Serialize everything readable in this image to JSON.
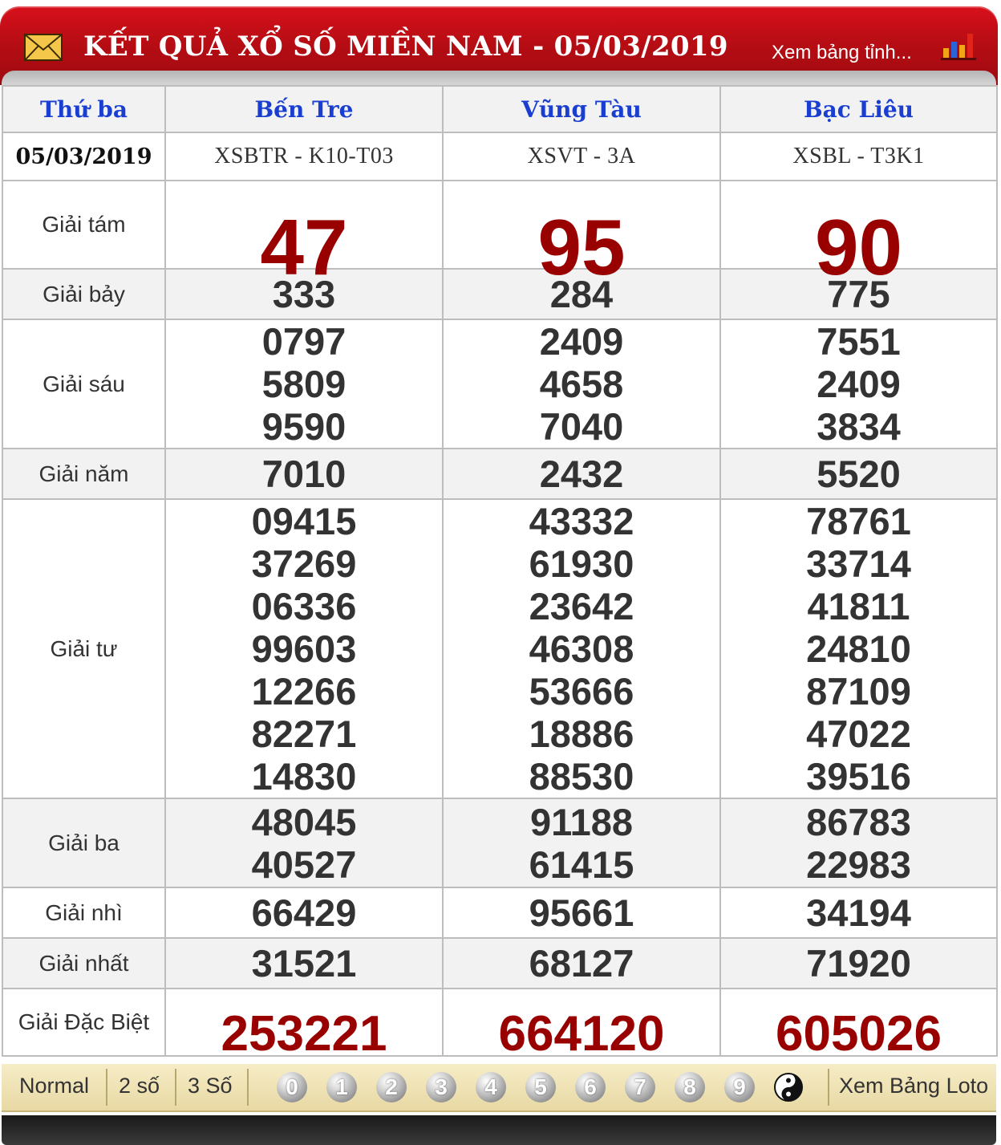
{
  "header": {
    "title": "KẾT QUẢ XỔ SỐ MIỀN NAM - 05/03/2019",
    "view_link": "Xem bảng tỉnh..."
  },
  "table": {
    "day": "Thứ ba",
    "date": "05/03/2019",
    "provinces": [
      {
        "name": "Bến Tre",
        "code": "XSBTR - K10-T03"
      },
      {
        "name": "Vũng Tàu",
        "code": "XSVT - 3A"
      },
      {
        "name": "Bạc Liêu",
        "code": "XSBL - T3K1"
      }
    ],
    "prizes": {
      "g8": {
        "label": "Giải tám",
        "values": [
          [
            "47"
          ],
          [
            "95"
          ],
          [
            "90"
          ]
        ]
      },
      "g7": {
        "label": "Giải bảy",
        "values": [
          [
            "333"
          ],
          [
            "284"
          ],
          [
            "775"
          ]
        ]
      },
      "g6": {
        "label": "Giải sáu",
        "values": [
          [
            "0797",
            "5809",
            "9590"
          ],
          [
            "2409",
            "4658",
            "7040"
          ],
          [
            "7551",
            "2409",
            "3834"
          ]
        ]
      },
      "g5": {
        "label": "Giải năm",
        "values": [
          [
            "7010"
          ],
          [
            "2432"
          ],
          [
            "5520"
          ]
        ]
      },
      "g4": {
        "label": "Giải tư",
        "values": [
          [
            "09415",
            "37269",
            "06336",
            "99603",
            "12266",
            "82271",
            "14830"
          ],
          [
            "43332",
            "61930",
            "23642",
            "46308",
            "53666",
            "18886",
            "88530"
          ],
          [
            "78761",
            "33714",
            "41811",
            "24810",
            "87109",
            "47022",
            "39516"
          ]
        ]
      },
      "g3": {
        "label": "Giải ba",
        "values": [
          [
            "48045",
            "40527"
          ],
          [
            "91188",
            "61415"
          ],
          [
            "86783",
            "22983"
          ]
        ]
      },
      "g2": {
        "label": "Giải nhì",
        "values": [
          [
            "66429"
          ],
          [
            "95661"
          ],
          [
            "34194"
          ]
        ]
      },
      "g1": {
        "label": "Giải nhất",
        "values": [
          [
            "31521"
          ],
          [
            "68127"
          ],
          [
            "71920"
          ]
        ]
      },
      "db": {
        "label": "Giải Đặc Biệt",
        "values": [
          [
            "253221"
          ],
          [
            "664120"
          ],
          [
            "605026"
          ]
        ]
      }
    }
  },
  "toolbar": {
    "normal": "Normal",
    "two_digits": "2 số",
    "three_digits": "3 Số",
    "balls": [
      "0",
      "1",
      "2",
      "3",
      "4",
      "5",
      "6",
      "7",
      "8",
      "9"
    ],
    "loto_link": "Xem Bảng Loto"
  },
  "colors": {
    "header_red": "#c00d16",
    "province_blue": "#1a3fd0",
    "highlight_red": "#990000",
    "toolbar_bg": "#f0e3b5"
  },
  "icons": {
    "envelope": "envelope-icon",
    "chart": "bar-chart-icon",
    "yinyang": "yin-yang-icon"
  }
}
